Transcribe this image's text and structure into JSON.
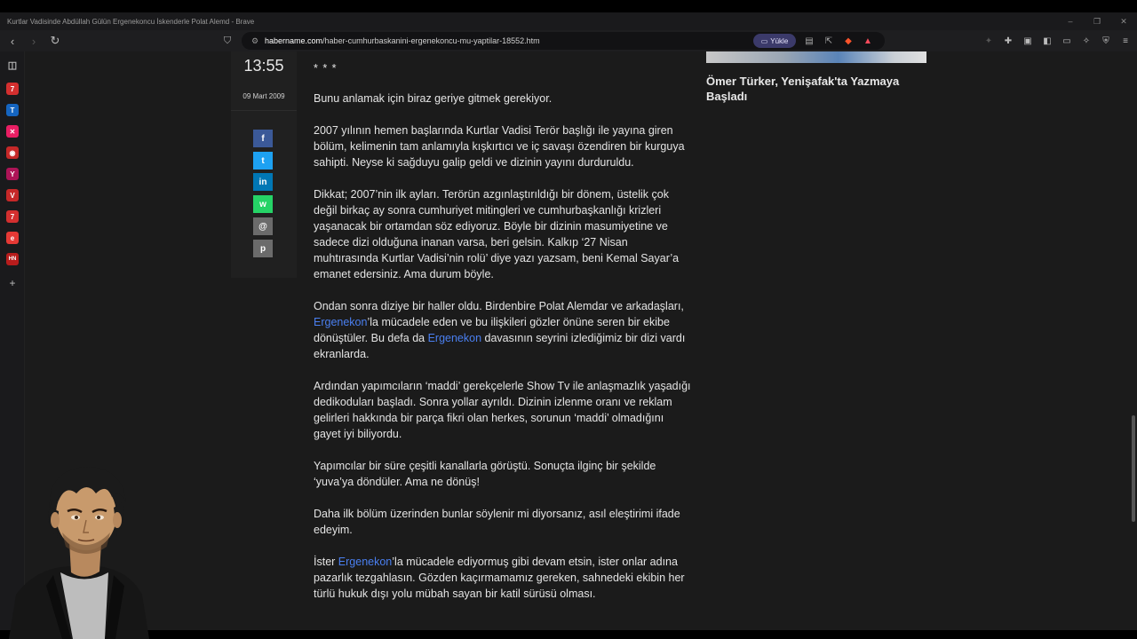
{
  "window": {
    "title": "Kurtlar Vadisinde Abdüllah Gülün Ergenekoncu İskenderle Polat Alemd - Brave"
  },
  "toolbar": {
    "url_domain": "habername.com",
    "url_path": "/haber-cumhurbaskanini-ergenekoncu-mu-yaptilar-18552.htm",
    "yukle_label": "Yükle"
  },
  "sidebar": {
    "items": [
      {
        "label": "7",
        "color": "#d32f2f"
      },
      {
        "label": "T",
        "color": "#1565c0"
      },
      {
        "label": "✕",
        "color": "#e91e63"
      },
      {
        "label": "◉",
        "color": "#c62828"
      },
      {
        "label": "Y",
        "color": "#ad1457"
      },
      {
        "label": "V",
        "color": "#c62828"
      },
      {
        "label": "7",
        "color": "#d32f2f"
      },
      {
        "label": "e",
        "color": "#e53935"
      },
      {
        "label": "HN",
        "color": "#b71c1c"
      },
      {
        "label": "+",
        "color": "transparent"
      }
    ]
  },
  "meta": {
    "time": "13:55",
    "date": "09 Mart 2009"
  },
  "share": {
    "facebook": "f",
    "twitter": "t",
    "linkedin": "in",
    "whatsapp": "w",
    "email": "@",
    "print": "p"
  },
  "article": {
    "stars": "* * *",
    "p1": "Bunu anlamak için biraz geriye gitmek gerekiyor.",
    "p2": "2007 yılının hemen başlarında Kurtlar Vadisi Terör başlığı ile yayına giren bölüm, kelimenin tam anlamıyla kışkırtıcı ve iç savaşı özendiren bir kurguya sahipti. Neyse ki sağduyu galip geldi ve dizinin yayını durduruldu.",
    "p3": "Dikkat; 2007’nin ilk ayları. Terörün azgınlaştırıldığı bir dönem, üstelik çok değil birkaç ay sonra cumhuriyet mitingleri ve cumhurbaşkanlığı krizleri yaşanacak bir ortamdan söz ediyoruz. Böyle bir dizinin masumiyetine ve sadece dizi olduğuna inanan varsa, beri gelsin. Kalkıp ‘27 Nisan muhtırasında Kurtlar Vadisi’nin rolü’ diye yazı yazsam, beni Kemal Sayar’a emanet edersiniz. Ama durum böyle.",
    "p4_a": "Ondan sonra diziye bir haller oldu. Birdenbire Polat Alemdar ve arkadaşları, ",
    "p4_link1": "Ergenekon",
    "p4_b": "’la mücadele eden ve bu ilişkileri gözler önüne seren bir ekibe dönüştüler. Bu defa da ",
    "p4_link2": "Ergenekon",
    "p4_c": " davasının seyrini izlediğimiz bir dizi vardı ekranlarda.",
    "p5": "Ardından yapımcıların ‘maddi’ gerekçelerle Show Tv ile anlaşmazlık yaşadığı dedikoduları başladı. Sonra yollar ayrıldı. Dizinin izlenme oranı ve reklam gelirleri hakkında bir parça fikri olan herkes, sorunun ‘maddi’ olmadığını gayet iyi biliyordu.",
    "p6": "Yapımcılar bir süre çeşitli kanallarla görüştü. Sonuçta ilginç bir şekilde ‘yuva’ya döndüler. Ama ne dönüş!",
    "p7": "Daha ilk bölüm üzerinden bunlar söylenir mi diyorsanız, asıl eleştirimi ifade edeyim.",
    "p8_a": "İster ",
    "p8_link": "Ergenekon",
    "p8_b": "’la mücadele ediyormuş gibi devam etsin, ister onlar adına pazarlık tezgahlasın. Gözden kaçırmamamız gereken, sahnedeki ekibin her türlü hukuk dışı yolu mübah sayan bir katil sürüsü olması."
  },
  "related": {
    "title": "Ömer Türker, Yenişafak'ta Yazmaya Başladı"
  },
  "colors": {
    "link": "#4a7ff0",
    "background": "#1b1b1b",
    "facebook": "#3b5998",
    "twitter": "#1da1f2",
    "linkedin": "#0077b5",
    "whatsapp": "#25d366",
    "gray": "#6b6b6b"
  }
}
